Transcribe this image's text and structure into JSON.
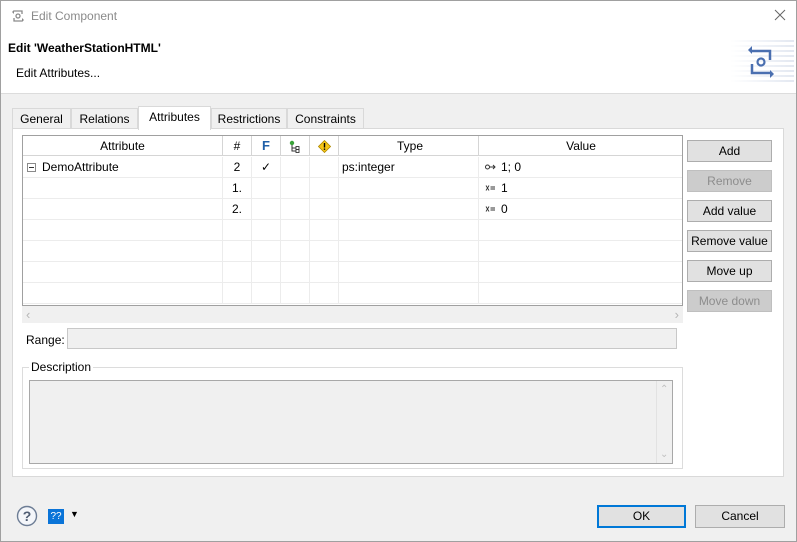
{
  "window": {
    "title": "Edit Component",
    "icons": {
      "app": "component-icon",
      "close": "close-icon"
    }
  },
  "header": {
    "title": "Edit 'WeatherStationHTML'",
    "subtitle": "Edit Attributes...",
    "banner_icon": "component-banner-icon"
  },
  "tabs": [
    {
      "label": "General",
      "active": false
    },
    {
      "label": "Relations",
      "active": false
    },
    {
      "label": "Attributes",
      "active": true
    },
    {
      "label": "Restrictions",
      "active": false
    },
    {
      "label": "Constraints",
      "active": false
    }
  ],
  "table": {
    "columns": [
      {
        "label": "Attribute"
      },
      {
        "label": "#"
      },
      {
        "label": "F",
        "color": "#1f5fa8"
      },
      {
        "label": "",
        "icon": "hierarchy-icon"
      },
      {
        "label": "",
        "icon": "warning-icon"
      },
      {
        "label": "Type"
      },
      {
        "label": "Value"
      }
    ],
    "rows": [
      {
        "attribute": "DemoAttribute",
        "expander": "collapse-icon",
        "count": "2",
        "f": "✓",
        "type": "ps:integer",
        "value_icon": "list-value-icon",
        "value": "1; 0"
      },
      {
        "attribute": "",
        "count": "1.",
        "f": "",
        "type": "",
        "value_icon": "assign-value-icon",
        "value": "1"
      },
      {
        "attribute": "",
        "count": "2.",
        "f": "",
        "type": "",
        "value_icon": "assign-value-icon",
        "value": "0"
      }
    ],
    "empty_rows": 4
  },
  "range": {
    "label": "Range:",
    "value": ""
  },
  "description": {
    "label": "Description",
    "value": ""
  },
  "side_buttons": [
    {
      "label": "Add",
      "enabled": true
    },
    {
      "label": "Remove",
      "enabled": false
    },
    {
      "label": "Add value",
      "enabled": true
    },
    {
      "label": "Remove value",
      "enabled": true
    },
    {
      "label": "Move up",
      "enabled": true
    },
    {
      "label": "Move down",
      "enabled": false
    }
  ],
  "footer": {
    "help_icon": "help-icon",
    "language_label": "??",
    "dropdown_icon": "dropdown-arrow-icon",
    "ok_label": "OK",
    "cancel_label": "Cancel"
  },
  "colors": {
    "accent": "#0078d7",
    "language_badge": "#0a74d8",
    "banner_icon": "#4a6fb0"
  }
}
